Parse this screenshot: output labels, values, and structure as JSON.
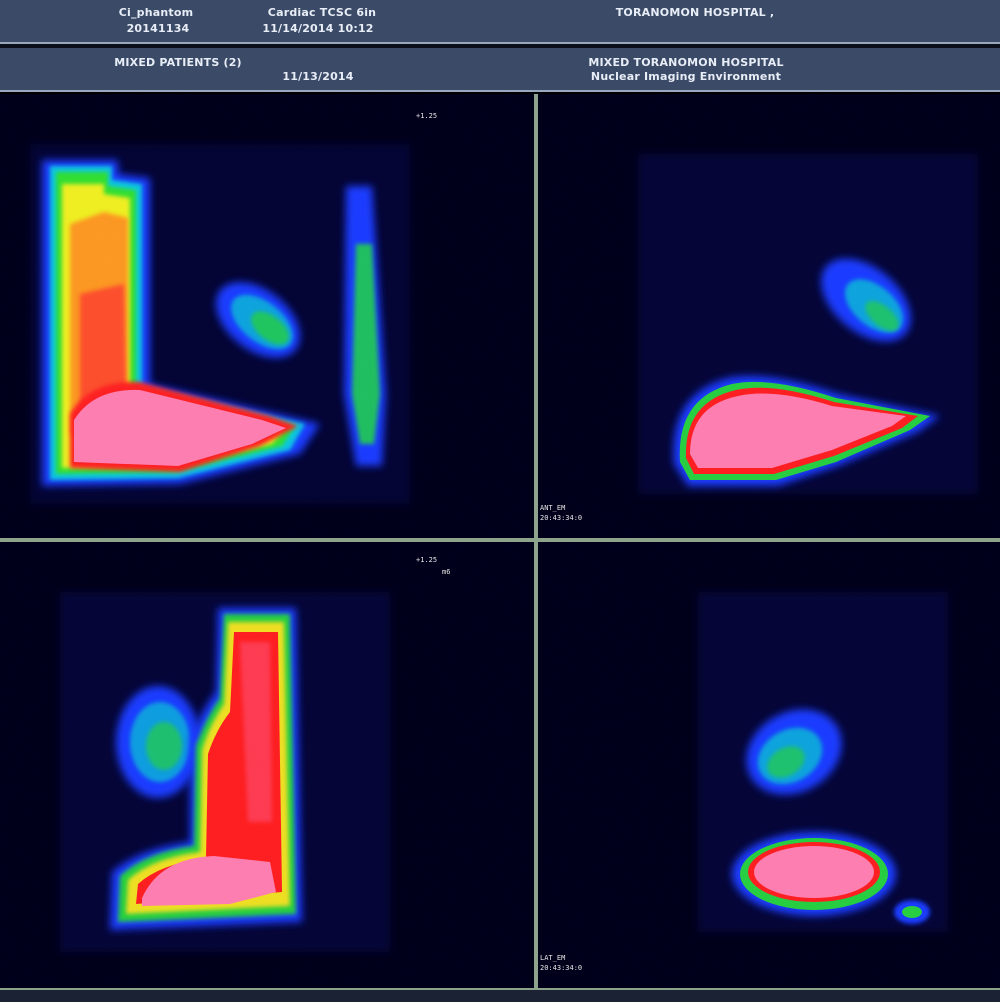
{
  "header": {
    "patient_name": "Ci_phantom",
    "patient_id": "20141134",
    "study_name": "Cardiac TCSC 6in",
    "study_datetime": "11/14/2014 10:12",
    "hospital": "TORANOMON HOSPITAL ,"
  },
  "subheader": {
    "group": "MIXED PATIENTS (2)",
    "date": "11/13/2014",
    "institution": "MIXED TORANOMON HOSPITAL",
    "environment": "Nuclear Imaging Environment"
  },
  "panes": {
    "top_left": {
      "scale_label": "+1.25"
    },
    "top_right": {
      "view_label": "ANT_EM",
      "time_label": "20:43:34:0"
    },
    "bottom_left": {
      "scale_label": "+1.25",
      "extra_label": "m6"
    },
    "bottom_right": {
      "view_label": "LAT_EM",
      "time_label": "20:43:34:0"
    }
  },
  "colors": {
    "header_bg": "#3b4a66",
    "divider": "#8ea38c",
    "hot": "#ff7fb0",
    "background": "#00001a"
  }
}
